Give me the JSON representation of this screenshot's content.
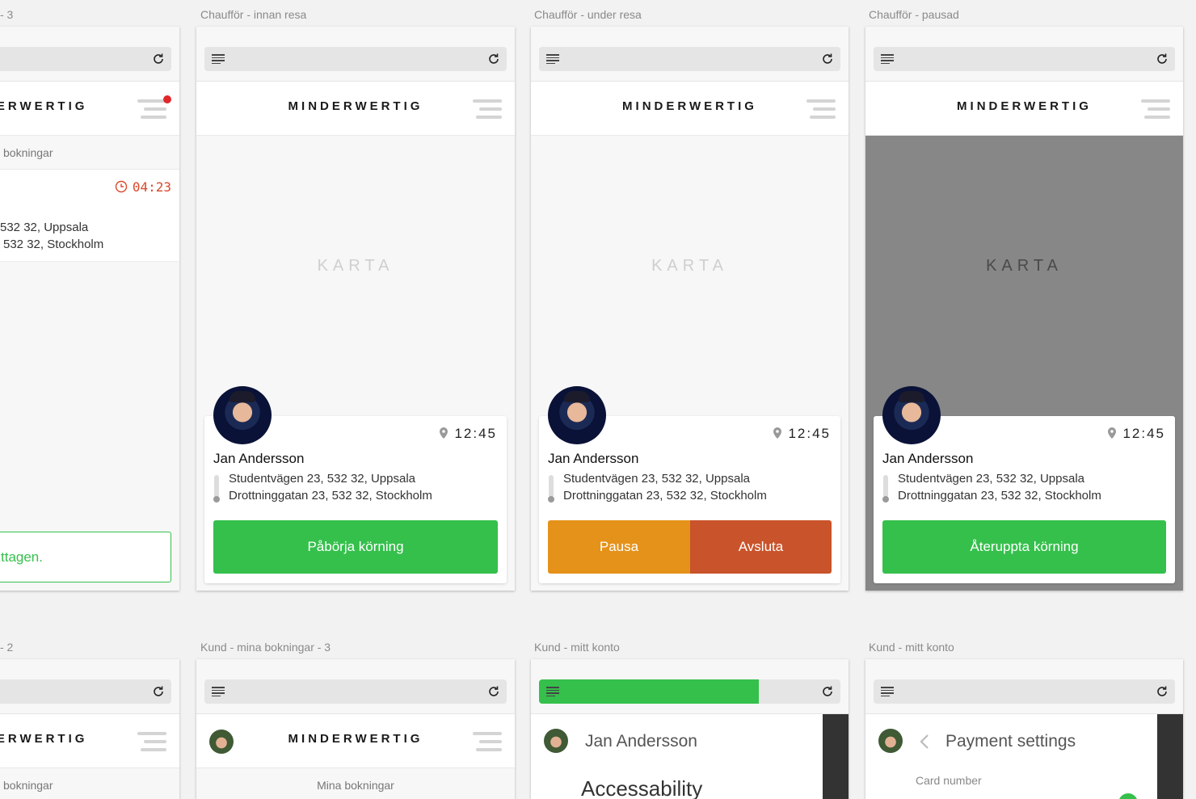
{
  "frames": {
    "f0": {
      "label": "- 3",
      "logo": "MINDERWERTIG",
      "subbar": "bokningar",
      "timer": "04:23",
      "addr1": "532 32, Uppsala",
      "addr2": "532 32, Stockholm",
      "button": "ttagen."
    },
    "f1": {
      "label": "Chaufför - innan resa",
      "logo": "MINDERWERTIG",
      "map": "KARTA",
      "time": "12:45",
      "name": "Jan Andersson",
      "addr1": "Studentvägen 23, 532 32, Uppsala",
      "addr2": "Drottninggatan 23, 532 32, Stockholm",
      "button": "Påbörja körning"
    },
    "f2": {
      "label": "Chaufför - under resa",
      "logo": "MINDERWERTIG",
      "map": "KARTA",
      "time": "12:45",
      "name": "Jan Andersson",
      "addr1": "Studentvägen 23, 532 32, Uppsala",
      "addr2": "Drottninggatan 23, 532 32, Stockholm",
      "pause": "Pausa",
      "end": "Avsluta"
    },
    "f3": {
      "label": "Chaufför - pausad",
      "logo": "MINDERWERTIG",
      "map": "KARTA",
      "time": "12:45",
      "name": "Jan Andersson",
      "addr1": "Studentvägen 23, 532 32, Uppsala",
      "addr2": "Drottninggatan 23, 532 32, Stockholm",
      "button": "Återuppta körning"
    },
    "f4": {
      "label": "- 2",
      "logo": "MINDERWERTIG",
      "subbar": "bokningar"
    },
    "f5": {
      "label": "Kund - mina bokningar - 3",
      "logo": "MINDERWERTIG",
      "subbar": "Mina bokningar"
    },
    "f6": {
      "label": "Kund - mitt konto",
      "name": "Jan Andersson",
      "section": "Accessability"
    },
    "f7": {
      "label": "Kund - mitt konto",
      "title": "Payment settings",
      "field": "Card number"
    }
  },
  "colors": {
    "green": "#35c04c",
    "orange": "#e5921a",
    "red_orange": "#c9532a",
    "timer_red": "#d9482b"
  }
}
